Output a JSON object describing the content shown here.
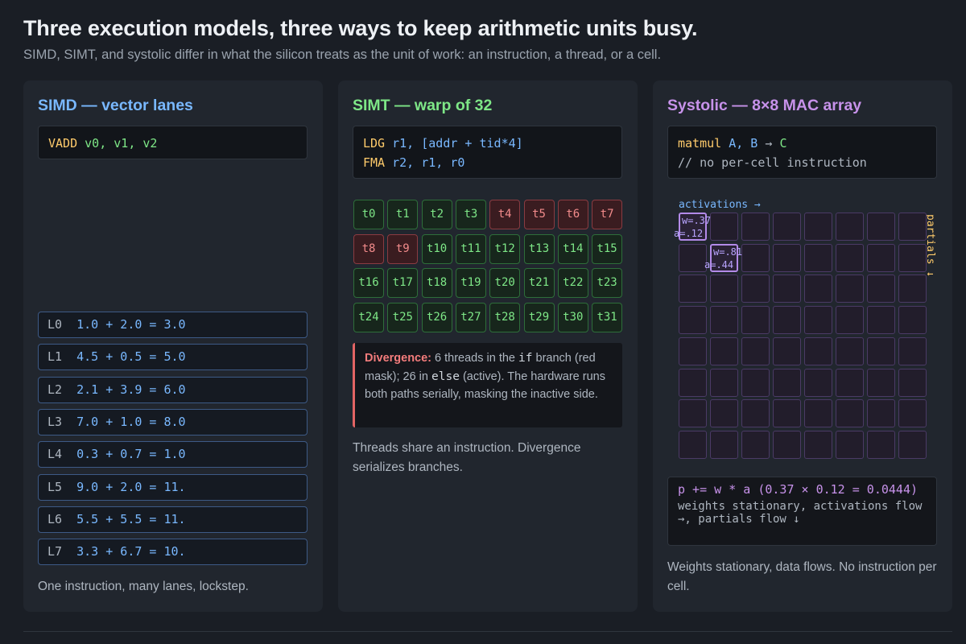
{
  "header": {
    "title": "Three execution models, three ways to keep arithmetic units busy.",
    "subtitle": "SIMD, SIMT, and systolic differ in what the silicon treats as the unit of work: an instruction, a thread, or a cell."
  },
  "simd": {
    "title": "SIMD — vector lanes",
    "code": {
      "op": "VADD",
      "args": " v0, v1, v2"
    },
    "lanes": [
      {
        "name": "L0",
        "expr": "1.0 + 2.0 = 3.0"
      },
      {
        "name": "L1",
        "expr": "4.5 + 0.5 = 5.0"
      },
      {
        "name": "L2",
        "expr": "2.1 + 3.9 = 6.0"
      },
      {
        "name": "L3",
        "expr": "7.0 + 1.0 = 8.0"
      },
      {
        "name": "L4",
        "expr": "0.3 + 0.7 = 1.0"
      },
      {
        "name": "L5",
        "expr": "9.0 + 2.0 = 11."
      },
      {
        "name": "L6",
        "expr": "5.5 + 5.5 = 11."
      },
      {
        "name": "L7",
        "expr": "3.3 + 6.7 = 10."
      }
    ],
    "caption": "One instruction, many lanes, lockstep."
  },
  "simt": {
    "title": "SIMT — warp of 32",
    "code": {
      "l1_op": "LDG",
      "l1_reg": " r1, ",
      "l1_addr": "[addr + tid*4]",
      "l2_op": "FMA",
      "l2_args": " r2, r1, r0"
    },
    "threads": [
      "t0",
      "t1",
      "t2",
      "t3",
      "t4",
      "t5",
      "t6",
      "t7",
      "t8",
      "t9",
      "t10",
      "t11",
      "t12",
      "t13",
      "t14",
      "t15",
      "t16",
      "t17",
      "t18",
      "t19",
      "t20",
      "t21",
      "t22",
      "t23",
      "t24",
      "t25",
      "t26",
      "t27",
      "t28",
      "t29",
      "t30",
      "t31"
    ],
    "masked_threads": [
      4,
      5,
      6,
      7,
      8,
      9
    ],
    "divergence": {
      "heading": "Divergence:",
      "t1": " 6 threads in the ",
      "kw_if": "if",
      "t2": " branch (red mask); 26 in ",
      "kw_else": "else",
      "t3": " (active). The hardware runs both paths serially, masking the inactive side."
    },
    "caption": "Threads share an instruction. Divergence serializes branches."
  },
  "systolic": {
    "title": "Systolic — 8×8 MAC array",
    "code": {
      "op": "matmul",
      "args_a": " A, B",
      "arrow": " → ",
      "args_c": "C",
      "comment": "// no per-cell instruction"
    },
    "grid": {
      "rows": 8,
      "cols": 8,
      "active_cells": [
        [
          0,
          0
        ],
        [
          1,
          1
        ]
      ]
    },
    "label_activations": "activations →",
    "label_partials": "partials ↓",
    "cell0": {
      "w": "w=.37",
      "a": "a=.12"
    },
    "cell1": {
      "w": "w=.81",
      "a": "a=.44"
    },
    "formula": {
      "line1": "p += w * a    (0.37 × 0.12 = 0.0444)",
      "line2": "weights stationary, activations flow →, partials flow ↓"
    },
    "caption": "Weights stationary, data flows. No instruction per cell."
  },
  "colors": {
    "simd_accent": "#79b8ff",
    "simt_accent": "#7ee787",
    "systolic_accent": "#c792ea",
    "opcode": "#ffcb6b",
    "masked": "#f28b8b"
  }
}
